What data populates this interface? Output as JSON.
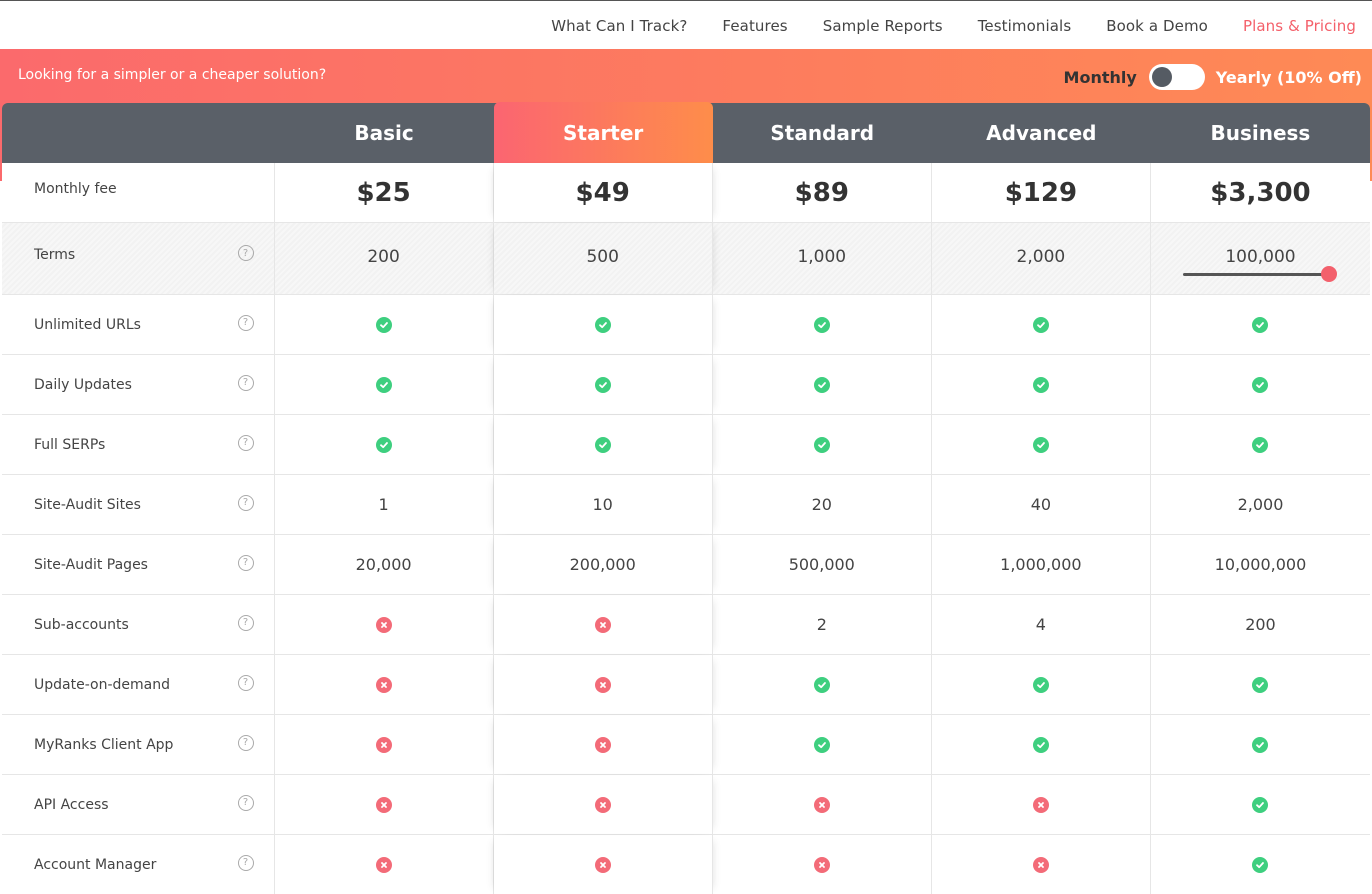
{
  "nav": {
    "links": [
      "What Can I Track?",
      "Features",
      "Sample Reports",
      "Testimonials",
      "Book a Demo",
      "Plans & Pricing"
    ],
    "active": "Plans & Pricing"
  },
  "banner": {
    "promo": "Looking for a simpler or a cheaper solution?",
    "toggle_monthly": "Monthly",
    "toggle_yearly": "Yearly (10% Off)",
    "billing_yearly_selected": false
  },
  "plans": [
    "Basic",
    "Starter",
    "Standard",
    "Advanced",
    "Business"
  ],
  "featured_plan": "Starter",
  "price_row": {
    "label": "Monthly fee",
    "values": [
      "$25",
      "$49",
      "$89",
      "$129",
      "$3,300"
    ]
  },
  "terms_row": {
    "label": "Terms",
    "values": [
      "200",
      "500",
      "1,000",
      "2,000",
      "100,000"
    ],
    "business_slider_level": 1.0
  },
  "features": [
    {
      "label": "Unlimited URLs",
      "values": [
        "ok",
        "ok",
        "ok",
        "ok",
        "ok"
      ]
    },
    {
      "label": "Daily Updates",
      "values": [
        "ok",
        "ok",
        "ok",
        "ok",
        "ok"
      ]
    },
    {
      "label": "Full SERPs",
      "values": [
        "ok",
        "ok",
        "ok",
        "ok",
        "ok"
      ]
    },
    {
      "label": "Site-Audit Sites",
      "values": [
        "1",
        "10",
        "20",
        "40",
        "2,000"
      ]
    },
    {
      "label": "Site-Audit Pages",
      "values": [
        "20,000",
        "200,000",
        "500,000",
        "1,000,000",
        "10,000,000"
      ]
    },
    {
      "label": "Sub-accounts",
      "values": [
        "no",
        "no",
        "2",
        "4",
        "200"
      ]
    },
    {
      "label": "Update-on-demand",
      "values": [
        "no",
        "no",
        "ok",
        "ok",
        "ok"
      ]
    },
    {
      "label": "MyRanks Client App",
      "values": [
        "no",
        "no",
        "ok",
        "ok",
        "ok"
      ]
    },
    {
      "label": "API Access",
      "values": [
        "no",
        "no",
        "no",
        "no",
        "ok"
      ]
    },
    {
      "label": "Account Manager",
      "values": [
        "no",
        "no",
        "no",
        "no",
        "ok"
      ]
    }
  ],
  "colors": {
    "accent": "#f4606a",
    "header_bg": "#5a6068",
    "check": "#3ecf7f",
    "cross": "#f36b78"
  }
}
